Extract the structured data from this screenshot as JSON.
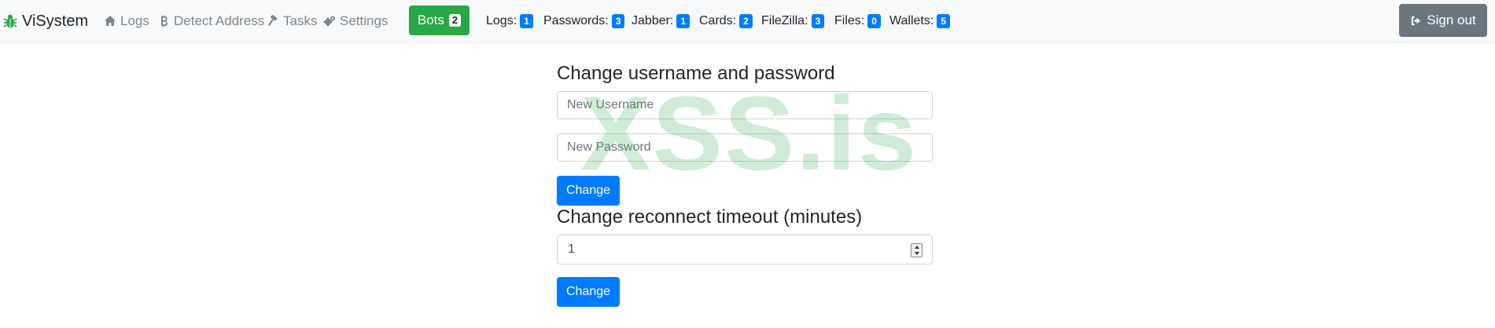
{
  "brand": {
    "name": "ViSystem",
    "icon": "bug-icon",
    "color": "#28a745"
  },
  "nav": {
    "items": [
      {
        "label": "Logs",
        "icon": "home-icon"
      },
      {
        "label": "Detect Address",
        "icon": "bitcoin-icon"
      },
      {
        "label": "Tasks",
        "icon": "gavel-icon"
      },
      {
        "label": "Settings",
        "icon": "gears-icon"
      }
    ]
  },
  "bots": {
    "label": "Bots",
    "count": "2"
  },
  "stats": [
    {
      "label": "Logs:",
      "count": "1"
    },
    {
      "label": "Passwords:",
      "count": "3"
    },
    {
      "label": "Jabber:",
      "count": "1"
    },
    {
      "label": "Cards:",
      "count": "2"
    },
    {
      "label": "FileZilla:",
      "count": "3"
    },
    {
      "label": "Files:",
      "count": "0"
    },
    {
      "label": "Wallets:",
      "count": "5"
    }
  ],
  "signout": {
    "label": "Sign out",
    "icon": "sign-out-icon"
  },
  "credentials": {
    "heading": "Change username and password",
    "username_placeholder": "New Username",
    "password_placeholder": "New Password",
    "button": "Change"
  },
  "timeout": {
    "heading": "Change reconnect timeout (minutes)",
    "value": "1",
    "button": "Change"
  },
  "watermark": "XSS.is",
  "colors": {
    "primary": "#007bff",
    "success": "#28a745",
    "secondary": "#6c757d",
    "navbar": "#f8f9fa"
  }
}
